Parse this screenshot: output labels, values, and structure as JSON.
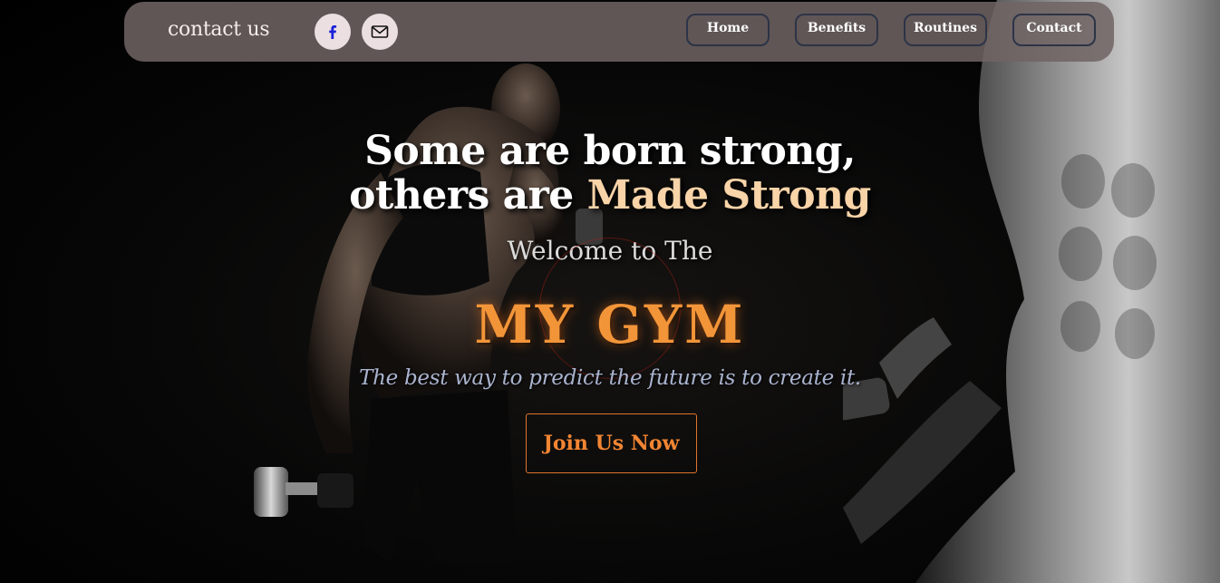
{
  "navbar": {
    "brand": "contact us",
    "social": [
      {
        "icon": "facebook-icon",
        "color": "#1a22d8"
      },
      {
        "icon": "mail-icon",
        "color": "#111111"
      }
    ],
    "links": [
      {
        "label": "Home"
      },
      {
        "label": "Benefits"
      },
      {
        "label": "Routines"
      },
      {
        "label": "Contact"
      }
    ]
  },
  "hero": {
    "headline_line1": "Some are born strong,",
    "headline_line2_prefix": "others are",
    "headline_line2_accent": "Made Strong",
    "welcome": "Welcome to The",
    "title": "MY GYM",
    "quote": "The best way to predict the future is to create it.",
    "cta": "Join Us Now"
  },
  "colors": {
    "accent_orange": "#f29539",
    "accent_peach": "#f9d4a8",
    "nav_bg": "#706464",
    "quote_blue": "#aab4cf"
  }
}
